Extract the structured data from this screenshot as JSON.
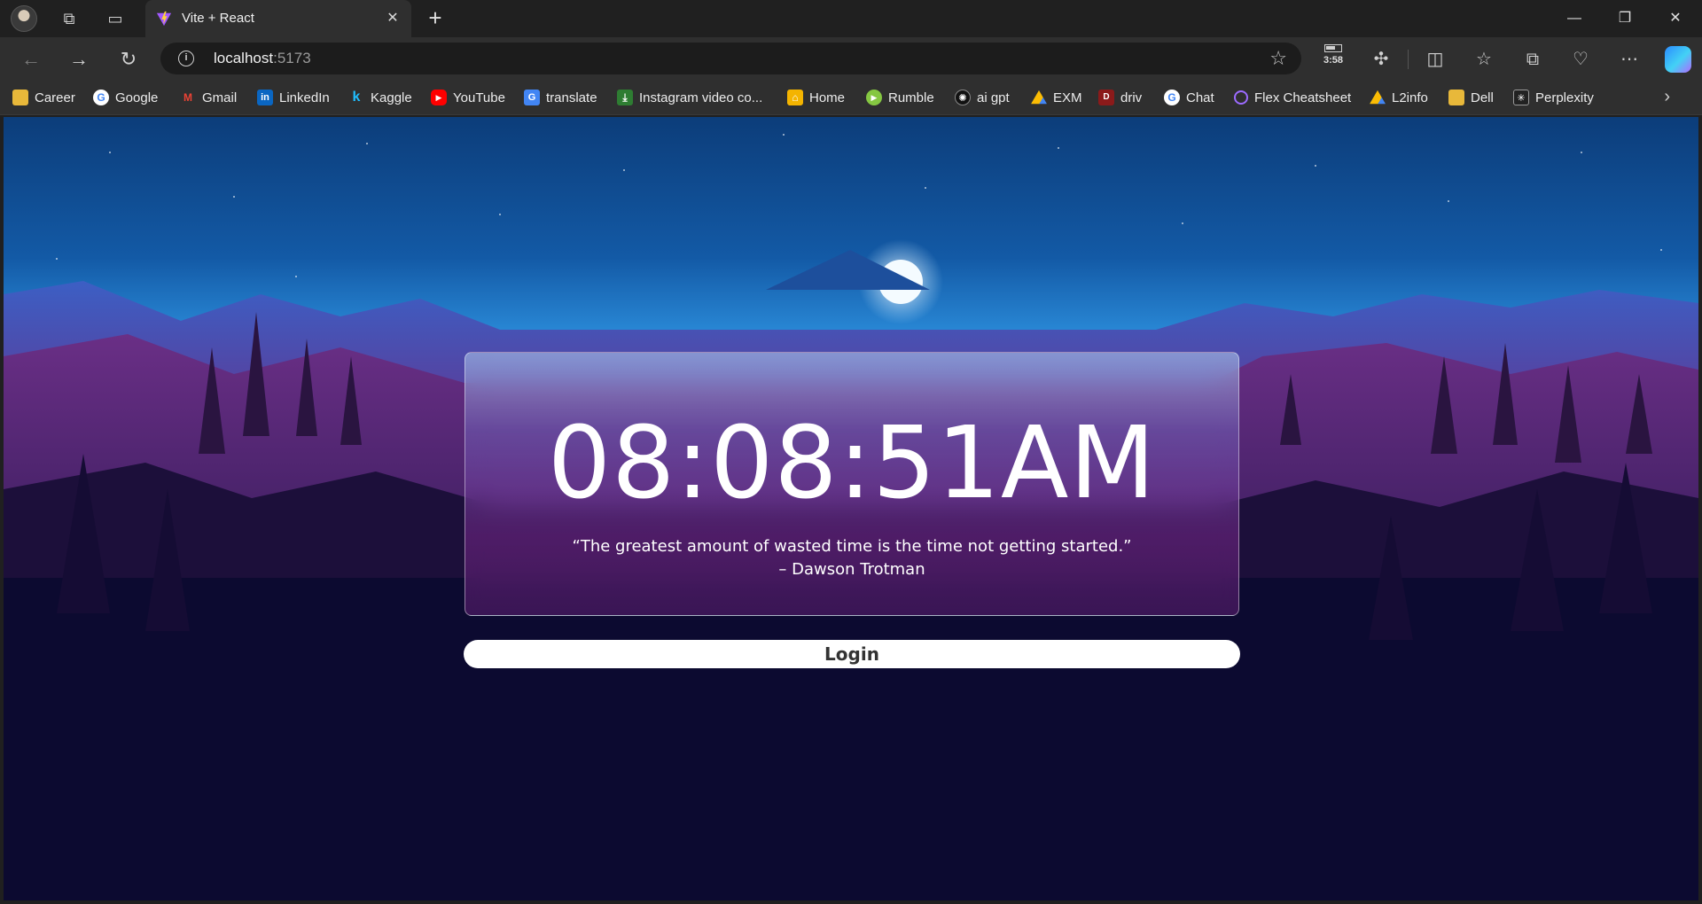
{
  "browser": {
    "tab": {
      "title": "Vite + React"
    },
    "address": {
      "host": "localhost",
      "port": ":5173"
    },
    "battery_time": "3:58",
    "bookmarks": [
      {
        "label": "Career",
        "icon": "folder-icon",
        "color": "#e8b83a"
      },
      {
        "label": "Google",
        "icon": "google-icon",
        "color": "#4285f4"
      },
      {
        "label": "Gmail",
        "icon": "gmail-icon",
        "color": "#ea4335"
      },
      {
        "label": "LinkedIn",
        "icon": "linkedin-icon",
        "color": "#0a66c2"
      },
      {
        "label": "Kaggle",
        "icon": "kaggle-icon",
        "color": "#20beff"
      },
      {
        "label": "YouTube",
        "icon": "youtube-icon",
        "color": "#ff0000"
      },
      {
        "label": "translate",
        "icon": "translate-icon",
        "color": "#4285f4"
      },
      {
        "label": "Instagram video co...",
        "icon": "download-icon",
        "color": "#2e7d32"
      },
      {
        "label": "Home",
        "icon": "home-icon",
        "color": "#f4b400"
      },
      {
        "label": "Rumble",
        "icon": "rumble-icon",
        "color": "#85c742"
      },
      {
        "label": "ai gpt",
        "icon": "openai-icon",
        "color": "#444444"
      },
      {
        "label": "EXM",
        "icon": "drive-icon",
        "color": "#34a853"
      },
      {
        "label": "driv",
        "icon": "driv-icon",
        "color": "#c62828"
      },
      {
        "label": "Chat",
        "icon": "google-icon",
        "color": "#4285f4"
      },
      {
        "label": "Flex Cheatsheet",
        "icon": "ring-icon",
        "color": "#9c6bff"
      },
      {
        "label": "L2info",
        "icon": "drive-icon",
        "color": "#34a853"
      },
      {
        "label": "Dell",
        "icon": "folder-icon",
        "color": "#e8b83a"
      },
      {
        "label": "Perplexity",
        "icon": "perplexity-icon",
        "color": "#555555"
      }
    ]
  },
  "page": {
    "time": "08:08:51AM",
    "quote": "“The greatest amount of wasted time is the time not getting started.”",
    "author": "– Dawson Trotman",
    "login_label": "Login"
  }
}
